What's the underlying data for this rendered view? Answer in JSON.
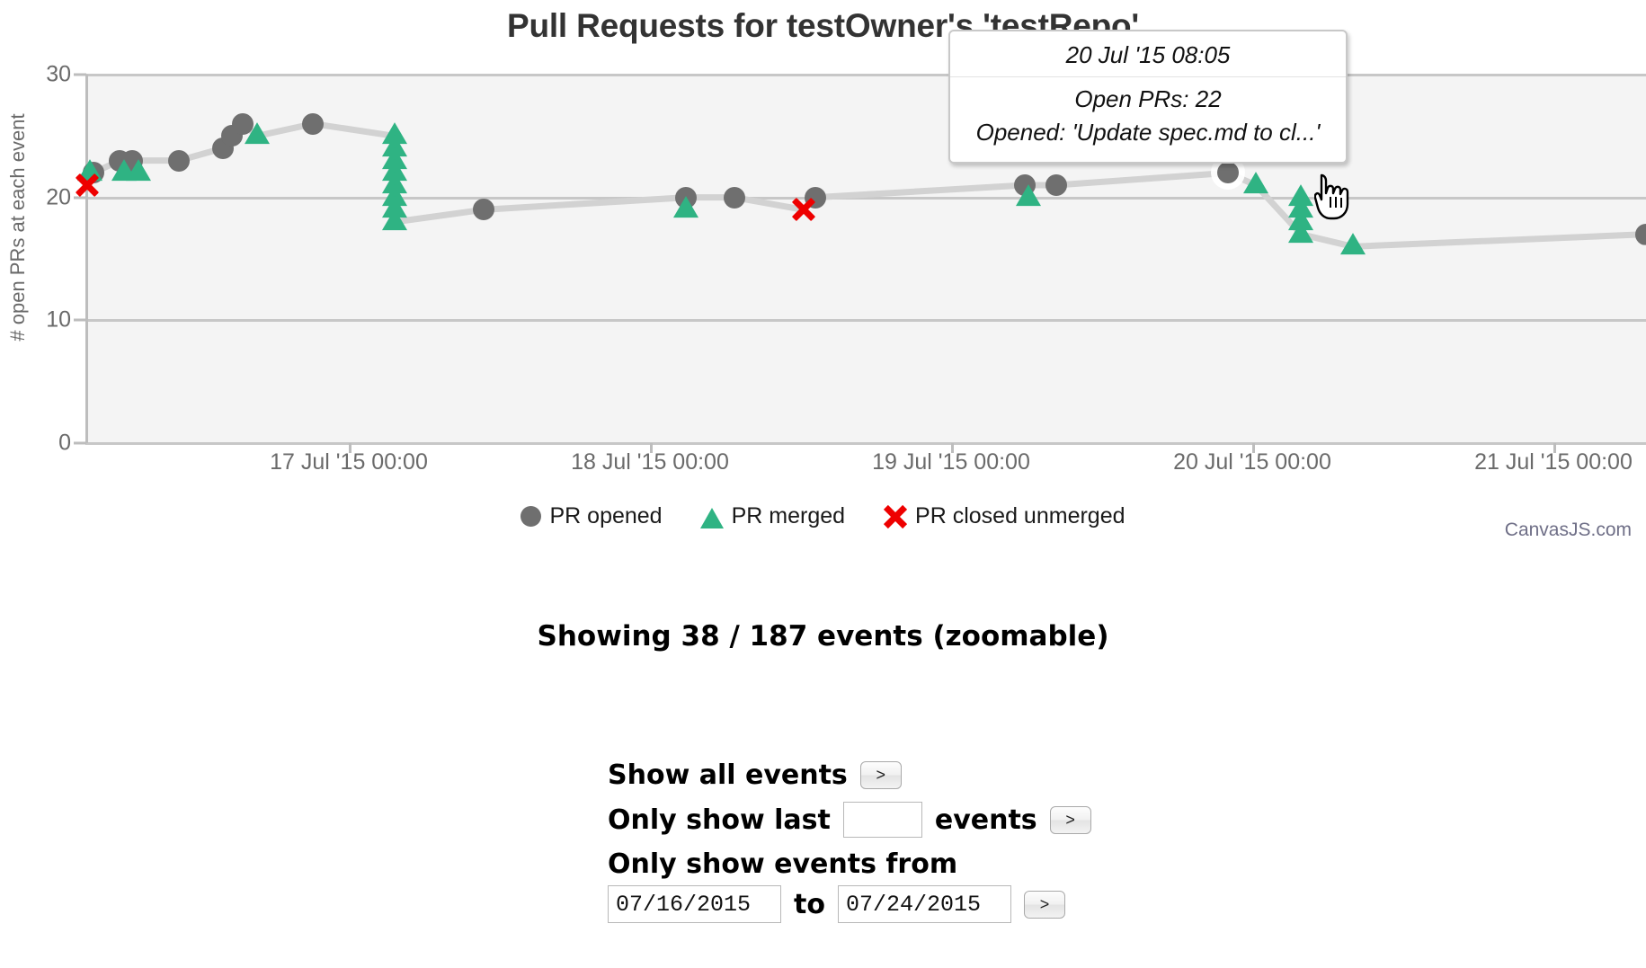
{
  "chart_title": "Pull Requests for testOwner's 'testRepo'",
  "credit": "CanvasJS.com",
  "tooltip": {
    "timestamp": "20 Jul '15 08:05",
    "open_prs": "Open PRs: 22",
    "opened": "Opened: 'Update spec.md to cl...'"
  },
  "legend": [
    {
      "label": "PR opened",
      "icon": "circle-marker-icon",
      "color": "#6f6f6f"
    },
    {
      "label": "PR merged",
      "icon": "triangle-marker-icon",
      "color": "#2fb383"
    },
    {
      "label": "PR closed unmerged",
      "icon": "cross-marker-icon",
      "color": "#ee0000"
    }
  ],
  "status": {
    "showing_text": "Showing 38 / 187 events (zoomable)"
  },
  "controls": {
    "show_all_label": "Show all events",
    "show_all_button": ">",
    "only_last_prefix": "Only show last",
    "only_last_value": "",
    "only_last_suffix": "events",
    "only_last_button": ">",
    "date_range_label": "Only show events from",
    "date_from": "07/16/2015",
    "to_label": "to",
    "date_to": "07/24/2015",
    "date_range_button": ">"
  },
  "chart_data": {
    "type": "scatter",
    "title": "Pull Requests for testOwner's 'testRepo'",
    "xlabel": "",
    "ylabel": "# open PRs at each event",
    "ylim": [
      0,
      30
    ],
    "y_ticks": [
      "0",
      "10",
      "20",
      "30"
    ],
    "x_ticks": [
      "17 Jul '15 00:00",
      "18 Jul '15 00:00",
      "19 Jul '15 00:00",
      "20 Jul '15 00:00",
      "21 Jul '15 00:00"
    ],
    "xlim": [
      "16 Jul '15 ~12:00",
      "21 Jul '15 ~12:00"
    ],
    "grid": true,
    "legend_position": "bottom",
    "series": [
      {
        "name": "PR opened",
        "marker": "circle",
        "color": "#6f6f6f",
        "points": [
          {
            "x": 0.5,
            "y": 22
          },
          {
            "x": 2.2,
            "y": 23
          },
          {
            "x": 3.0,
            "y": 23
          },
          {
            "x": 6.0,
            "y": 23
          },
          {
            "x": 8.8,
            "y": 24
          },
          {
            "x": 9.4,
            "y": 25
          },
          {
            "x": 10.1,
            "y": 26
          },
          {
            "x": 14.6,
            "y": 26
          },
          {
            "x": 25.5,
            "y": 19
          },
          {
            "x": 38.5,
            "y": 20
          },
          {
            "x": 41.6,
            "y": 20
          },
          {
            "x": 46.8,
            "y": 20
          },
          {
            "x": 60.2,
            "y": 21
          },
          {
            "x": 62.2,
            "y": 21
          },
          {
            "x": 73.2,
            "y": 22
          },
          {
            "x": 100.0,
            "y": 17
          }
        ]
      },
      {
        "name": "PR merged",
        "marker": "triangle",
        "color": "#2fb383",
        "points": [
          {
            "x": 0.3,
            "y": 22
          },
          {
            "x": 2.5,
            "y": 22
          },
          {
            "x": 3.4,
            "y": 22
          },
          {
            "x": 11.0,
            "y": 25
          },
          {
            "x": 19.8,
            "y": 25
          },
          {
            "x": 19.8,
            "y": 24
          },
          {
            "x": 19.8,
            "y": 23
          },
          {
            "x": 19.8,
            "y": 22
          },
          {
            "x": 19.8,
            "y": 21
          },
          {
            "x": 19.8,
            "y": 20
          },
          {
            "x": 19.8,
            "y": 19
          },
          {
            "x": 19.8,
            "y": 18
          },
          {
            "x": 38.5,
            "y": 19
          },
          {
            "x": 60.4,
            "y": 20
          },
          {
            "x": 75.0,
            "y": 21
          },
          {
            "x": 77.9,
            "y": 20
          },
          {
            "x": 77.9,
            "y": 19
          },
          {
            "x": 77.9,
            "y": 18
          },
          {
            "x": 77.9,
            "y": 17
          },
          {
            "x": 81.2,
            "y": 16
          }
        ]
      },
      {
        "name": "PR closed unmerged",
        "marker": "cross",
        "color": "#ee0000",
        "points": [
          {
            "x": 0.1,
            "y": 21
          },
          {
            "x": 46.0,
            "y": 19
          }
        ]
      }
    ],
    "connector_line": {
      "color": "#d2d2d2",
      "points": [
        {
          "x": 0.1,
          "y": 21.3
        },
        {
          "x": 0.5,
          "y": 22
        },
        {
          "x": 2.2,
          "y": 23
        },
        {
          "x": 3.0,
          "y": 23
        },
        {
          "x": 6.0,
          "y": 23
        },
        {
          "x": 8.8,
          "y": 24
        },
        {
          "x": 9.4,
          "y": 25
        },
        {
          "x": 10.1,
          "y": 26
        },
        {
          "x": 11.0,
          "y": 25
        },
        {
          "x": 14.6,
          "y": 26
        },
        {
          "x": 19.8,
          "y": 25
        },
        {
          "x": 19.8,
          "y": 18
        },
        {
          "x": 25.5,
          "y": 19
        },
        {
          "x": 38.5,
          "y": 20
        },
        {
          "x": 41.6,
          "y": 20
        },
        {
          "x": 46.0,
          "y": 19
        },
        {
          "x": 46.8,
          "y": 20
        },
        {
          "x": 60.2,
          "y": 21
        },
        {
          "x": 62.2,
          "y": 21
        },
        {
          "x": 73.2,
          "y": 22
        },
        {
          "x": 75.0,
          "y": 21
        },
        {
          "x": 77.9,
          "y": 17
        },
        {
          "x": 81.2,
          "y": 16
        },
        {
          "x": 100.0,
          "y": 17
        }
      ]
    }
  }
}
